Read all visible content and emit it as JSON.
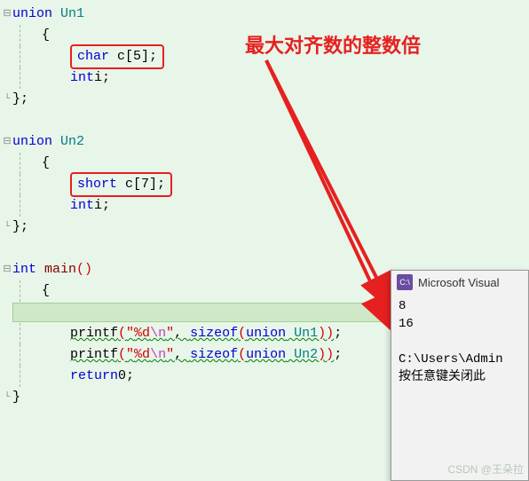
{
  "annotation": "最大对齐数的整数倍",
  "code": {
    "union1": {
      "keyword": "union",
      "name": "Un1",
      "open_brace": "{",
      "field1_type": "char",
      "field1_decl": " c[5];",
      "field2_type": "int",
      "field2_decl": " i;",
      "close": "};"
    },
    "union2": {
      "keyword": "union",
      "name": "Un2",
      "open_brace": "{",
      "field1_type": "short",
      "field1_decl": " c[7];",
      "field2_type": "int",
      "field2_decl": " i;",
      "close": "};"
    },
    "main": {
      "ret_type": "int",
      "name": "main",
      "parens": "()",
      "open_brace": "{",
      "printf1_func": "printf",
      "printf1_open": "(",
      "printf1_str_q1": "\"",
      "printf1_str_body": "%d",
      "printf1_esc": "\\n",
      "printf1_str_q2": "\"",
      "printf1_comma": ", ",
      "printf1_sizeof": "sizeof",
      "printf1_arg_open": "(",
      "printf1_union_kw": "union",
      "printf1_union_name": " Un1",
      "printf1_arg_close": "))",
      "printf1_semi": ";",
      "printf2_func": "printf",
      "printf2_union_name": " Un2",
      "return_kw": "return",
      "return_val": " 0;",
      "close_brace": "}"
    }
  },
  "terminal": {
    "title": "Microsoft Visual",
    "icon_text": "C:\\",
    "line1": "8",
    "line2": "16",
    "line3": "C:\\Users\\Admin",
    "line4": "按任意键关闭此"
  },
  "fold_minus": "⊟",
  "fold_end": "└",
  "watermark": "CSDN @王朵拉"
}
